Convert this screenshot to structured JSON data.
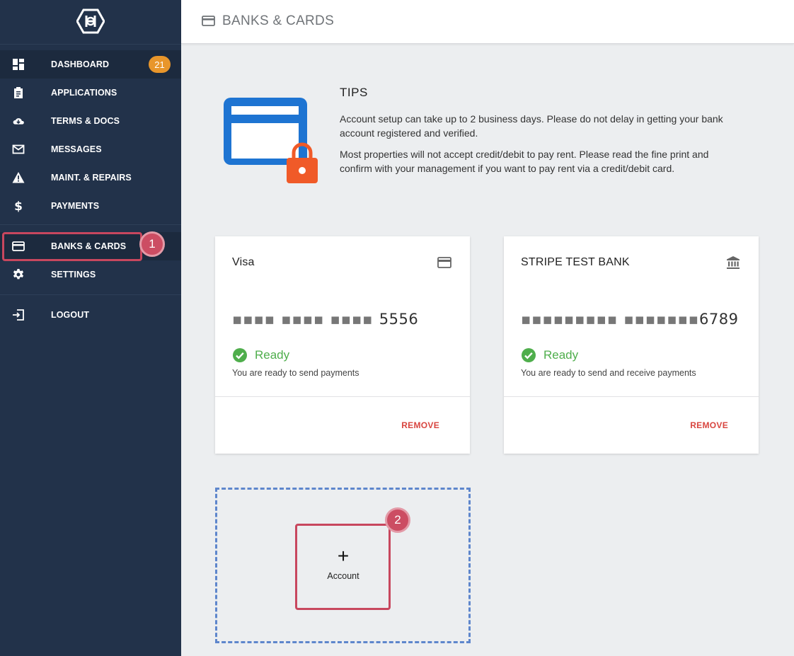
{
  "sidebar": {
    "dashboard_badge": "21",
    "items": [
      {
        "label": "DASHBOARD",
        "icon": "dashboard-icon"
      },
      {
        "label": "APPLICATIONS",
        "icon": "clipboard-icon"
      },
      {
        "label": "TERMS & DOCS",
        "icon": "cloud-download-icon"
      },
      {
        "label": "MESSAGES",
        "icon": "mail-icon"
      },
      {
        "label": "MAINT. & REPAIRS",
        "icon": "warning-icon"
      },
      {
        "label": "PAYMENTS",
        "icon": "dollar-icon"
      },
      {
        "label": "BANKS & CARDS",
        "icon": "credit-card-icon"
      },
      {
        "label": "SETTINGS",
        "icon": "gear-icon"
      },
      {
        "label": "LOGOUT",
        "icon": "logout-icon"
      }
    ]
  },
  "header": {
    "title": "BANKS & CARDS",
    "icon": "credit-card-icon"
  },
  "tips": {
    "title": "TIPS",
    "paragraph1": "Account setup can take up to 2 business days. Please do not delay in getting your bank account registered and verified.",
    "paragraph2": "Most properties will not accept credit/debit to pay rent. Please read the fine print and confirm with your management if you want to pay rent via a credit/debit card."
  },
  "accounts": [
    {
      "name": "Visa",
      "type_icon": "credit-card-icon",
      "masked_dots": "▪▪▪▪ ▪▪▪▪ ▪▪▪▪ ",
      "last_digits": "5556",
      "status": "Ready",
      "status_description": "You are ready to send payments",
      "remove_label": "REMOVE"
    },
    {
      "name": "STRIPE TEST BANK",
      "type_icon": "bank-icon",
      "masked_dots": "▪▪▪▪▪▪▪▪▪ ▪▪▪▪▪▪▪",
      "last_digits": "6789",
      "status": "Ready",
      "status_description": "You are ready to send and receive payments",
      "remove_label": "REMOVE"
    }
  ],
  "add_account": {
    "plus": "+",
    "label": "Account"
  },
  "annotations": {
    "step1": "1",
    "step2": "2"
  },
  "colors": {
    "sidebar_bg": "#22324a",
    "badge": "#e8962b",
    "ready_green": "#4fae4c",
    "remove_red": "#d8453f",
    "highlight": "#c8475e",
    "dashed_border": "#5e86cc"
  }
}
